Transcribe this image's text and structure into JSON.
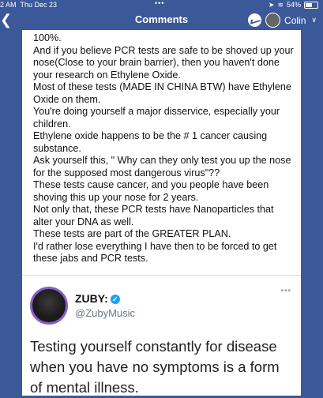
{
  "status_bar": {
    "time": "2 AM",
    "date": "Thu Dec 23",
    "dots": "•••",
    "battery": "54%"
  },
  "nav": {
    "back_icon": "chevron-left-icon",
    "title": "Comments",
    "user": "Colin",
    "chevron": "∨"
  },
  "comment": {
    "paragraphs": [
      "100%.",
      "And if you believe PCR tests are safe to be shoved up your nose(Close to your brain barrier), then you haven't done your research on Ethylene Oxide.",
      "Most of these tests (MADE IN CHINA BTW) have Ethylene Oxide on them.",
      "You're doing yourself a major disservice, especially your children.",
      "Ethylene oxide happens to be the # 1 cancer causing substance.",
      "Ask yourself this, \" Why can they only test you up the nose for the supposed most dangerous virus\"??",
      "These tests cause cancer, and you people have been shoving this up your nose for 2 years.",
      "Not only that, these PCR tests have Nanoparticles that alter your DNA as well.",
      "These tests are part of the GREATER PLAN.",
      "I'd rather lose everything I have then to be forced to get these jabs and PCR tests."
    ]
  },
  "embed": {
    "name": "ZUBY:",
    "verified": "✓",
    "handle": "@ZubyMusic",
    "more": "•••",
    "tweet": "Testing yourself constantly for disease when you have no symptoms is a form of mental illness."
  }
}
